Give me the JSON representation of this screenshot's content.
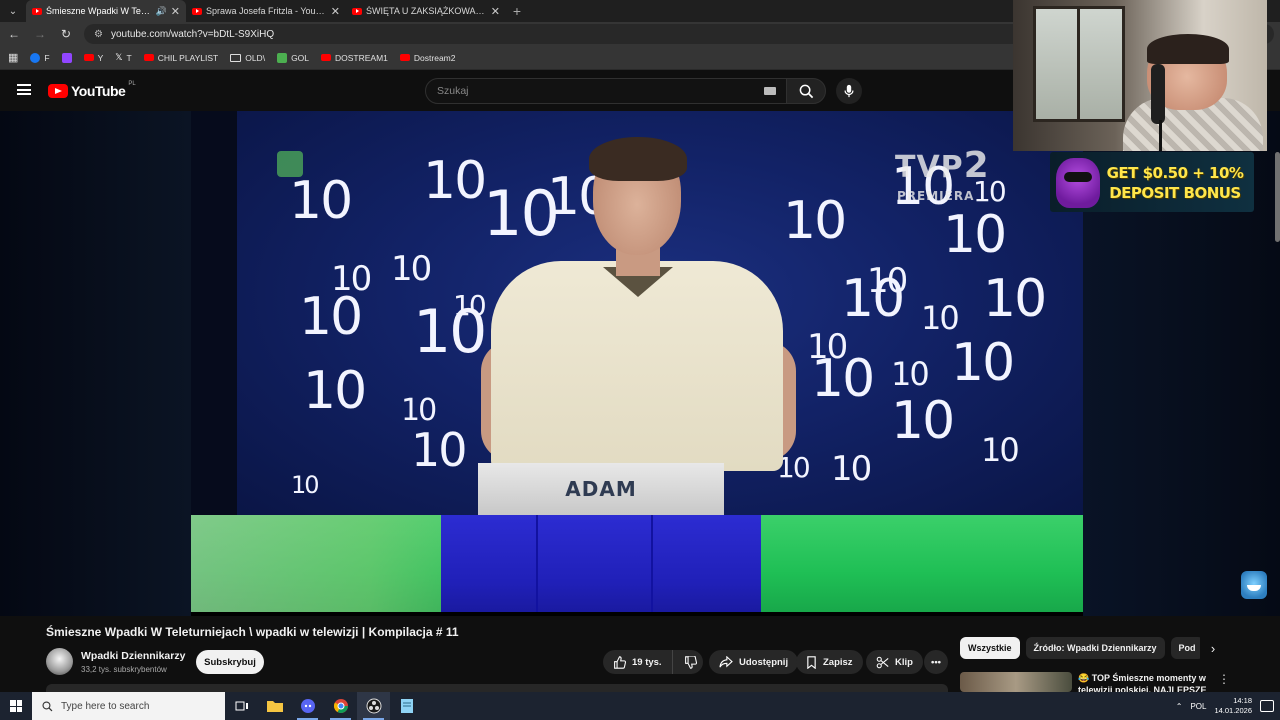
{
  "browser": {
    "tabs": [
      {
        "title": "Śmieszne Wpadki W Teleturniejach \\ wpadki w telewizji | Kompilacja # 11 - YouTube",
        "short": "Śmieszne Wpadki W Teleturn",
        "active": true,
        "audio": true
      },
      {
        "title": "Sprawa Josefa Fritzla - YouTube",
        "short": "Sprawa Josefa Fritzla - YouTube",
        "active": false
      },
      {
        "title": "ŚWIĘTA U ZAKSIĄŻKOWANYCH",
        "short": "ŚWIĘTA U ZAKSIĄŻKOWANYCH",
        "active": false
      }
    ],
    "new_tab_glyph": "+",
    "url": "youtube.com/watch?v=bDtL-S9XiHQ",
    "bookmarks": [
      {
        "label": "F",
        "icon": "facebook-icon"
      },
      {
        "label": "",
        "icon": "twitch-icon"
      },
      {
        "label": "Y",
        "icon": "youtube-icon"
      },
      {
        "label": "T",
        "icon": "x-icon"
      },
      {
        "label": "CHIL PLAYLIST",
        "icon": "youtube-icon"
      },
      {
        "label": "OLD\\",
        "icon": "folder-icon"
      },
      {
        "label": "GOL",
        "icon": "gol-icon"
      },
      {
        "label": "DOSTREAM1",
        "icon": "youtube-icon"
      },
      {
        "label": "Dostream2",
        "icon": "youtube-icon"
      }
    ]
  },
  "youtube": {
    "logo_text": "YouTube",
    "region": "PL",
    "search_placeholder": "Szukaj",
    "video": {
      "title": "Śmieszne Wpadki W Teleturniejach \\ wpadki w telewizji | Kompilacja # 11",
      "nameplate": "ADAM",
      "tv_logo_letters": "TVP",
      "tv_logo_number": "2",
      "tv_logo_sub": "PREMIERA",
      "wall_digit": "10"
    },
    "channel": {
      "name": "Wpadki Dziennikarzy",
      "subscribers": "33,2 tys. subskrybentów",
      "subscribe_label": "Subskrybuj"
    },
    "actions": {
      "likes": "19 tys.",
      "share": "Udostępnij",
      "save": "Zapisz",
      "clip": "Klip"
    },
    "chips": [
      "Wszystkie",
      "Źródło: Wpadki Dziennikarzy",
      "Pod"
    ],
    "recommendation": {
      "title": "😂 TOP Śmieszne momenty w telewizji polskiej. NAJLEPSZE"
    }
  },
  "ad": {
    "line1": "GET $0.50 + 10%",
    "line2": "DEPOSIT BONUS"
  },
  "taskbar": {
    "search_placeholder": "Type here to search",
    "language": "POL",
    "time": "14:18",
    "date": "14.01.2026"
  },
  "colors": {
    "youtube_red": "#ff0000",
    "page_bg": "#0f0f0f",
    "ad_text": "#ffe64a",
    "green_floor": "#1fbf55",
    "podium_blue": "#2020b8"
  }
}
